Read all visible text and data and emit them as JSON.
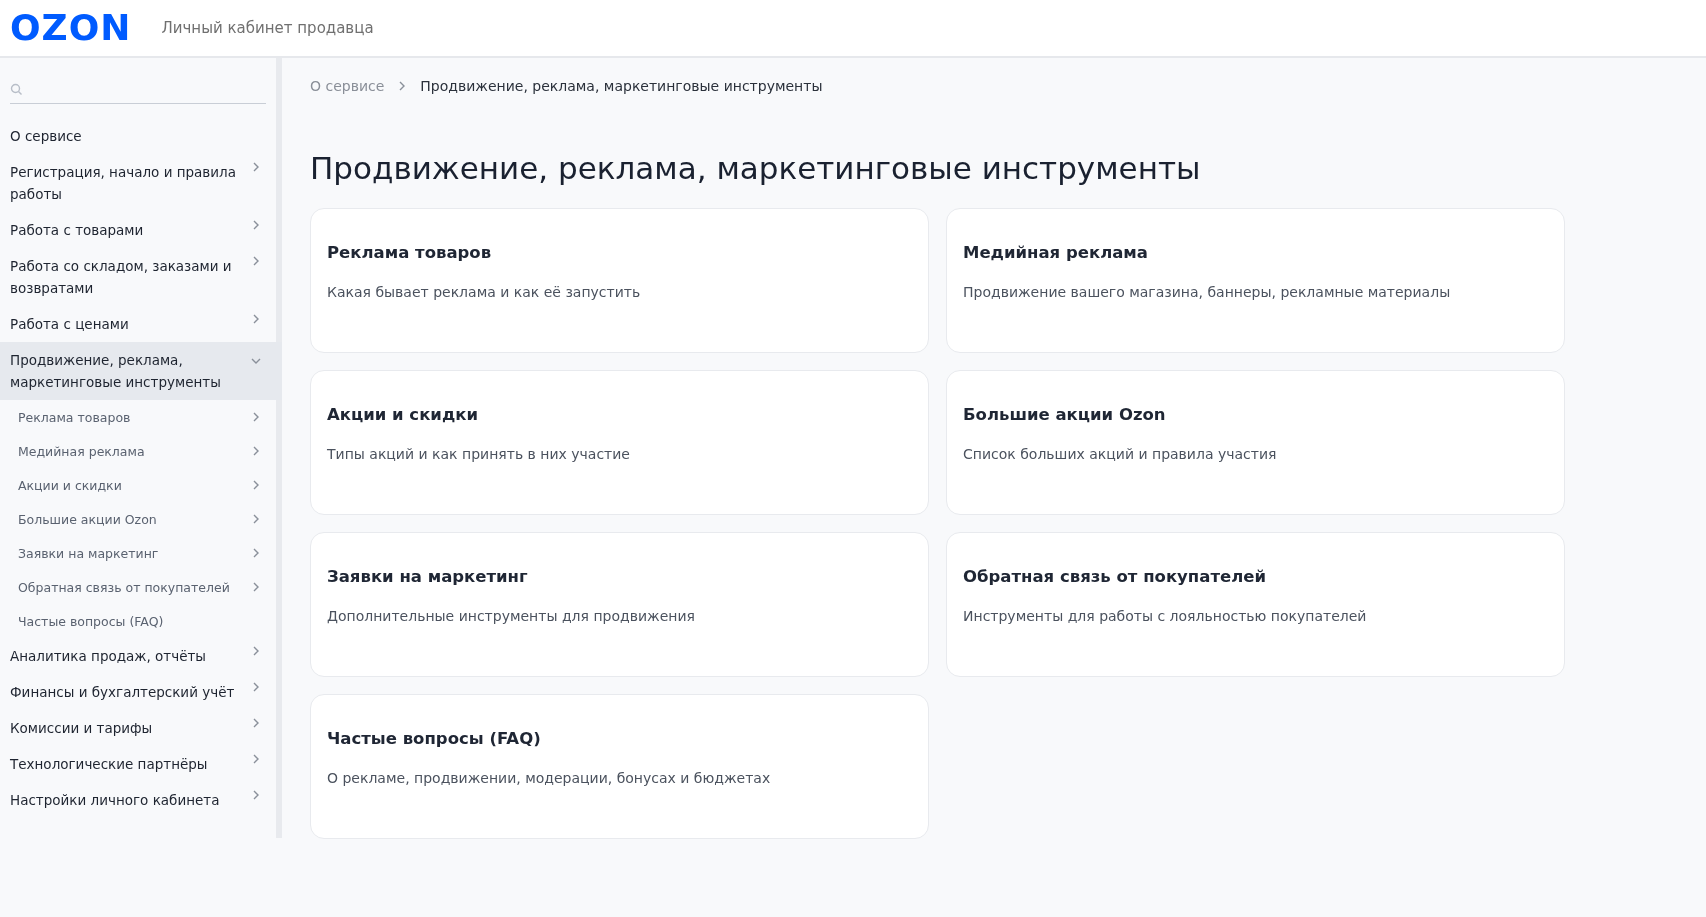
{
  "header": {
    "logo": "OZON",
    "title": "Личный кабинет продавца"
  },
  "sidebar": {
    "items": [
      {
        "label": "О сервисе",
        "kind": "link",
        "selected": false
      },
      {
        "label": "Регистрация, начало и правила работы",
        "kind": "folder",
        "expanded": false,
        "selected": false
      },
      {
        "label": "Работа с товарами",
        "kind": "folder",
        "expanded": false,
        "selected": false
      },
      {
        "label": "Работа со складом, заказами и возвратами",
        "kind": "folder",
        "expanded": false,
        "selected": false
      },
      {
        "label": "Работа с ценами",
        "kind": "folder",
        "expanded": false,
        "selected": false
      },
      {
        "label": "Продвижение, реклама, маркетинговые инструменты",
        "kind": "folder",
        "expanded": true,
        "selected": true,
        "children": [
          {
            "label": "Реклама товаров",
            "kind": "folder"
          },
          {
            "label": "Медийная реклама",
            "kind": "folder"
          },
          {
            "label": "Акции и скидки",
            "kind": "folder"
          },
          {
            "label": "Большие акции Ozon",
            "kind": "folder"
          },
          {
            "label": "Заявки на маркетинг",
            "kind": "folder"
          },
          {
            "label": "Обратная связь от покупателей",
            "kind": "folder"
          },
          {
            "label": "Частые вопросы (FAQ)",
            "kind": "link"
          }
        ]
      },
      {
        "label": "Аналитика продаж, отчёты",
        "kind": "folder",
        "expanded": false,
        "selected": false
      },
      {
        "label": "Финансы и бухгалтерский учёт",
        "kind": "folder",
        "expanded": false,
        "selected": false
      },
      {
        "label": "Комиссии и тарифы",
        "kind": "folder",
        "expanded": false,
        "selected": false
      },
      {
        "label": "Технологические партнёры",
        "kind": "folder",
        "expanded": false,
        "selected": false
      },
      {
        "label": "Настройки личного кабинета",
        "kind": "folder",
        "expanded": false,
        "selected": false
      }
    ]
  },
  "breadcrumbs": [
    "О сервисе",
    "Продвижение, реклама, маркетинговые инструменты"
  ],
  "page_title": "Продвижение, реклама, маркетинговые инструменты",
  "cards": [
    {
      "title": "Реклама товаров",
      "description": "Какая бывает реклама и как её запустить"
    },
    {
      "title": "Медийная реклама",
      "description": "Продвижение вашего магазина, баннеры, рекламные материалы"
    },
    {
      "title": "Акции и скидки",
      "description": "Типы акций и как принять в них участие"
    },
    {
      "title": "Большие акции Ozon",
      "description": "Список больших акций и правила участия"
    },
    {
      "title": "Заявки на маркетинг",
      "description": "Дополнительные инструменты для продвижения"
    },
    {
      "title": "Обратная связь от покупателей",
      "description": "Инструменты для работы с лояльностью покупателей"
    },
    {
      "title": "Частые вопросы (FAQ)",
      "description": "О рекламе, продвижении, модерации, бонусах и бюджетах"
    }
  ]
}
